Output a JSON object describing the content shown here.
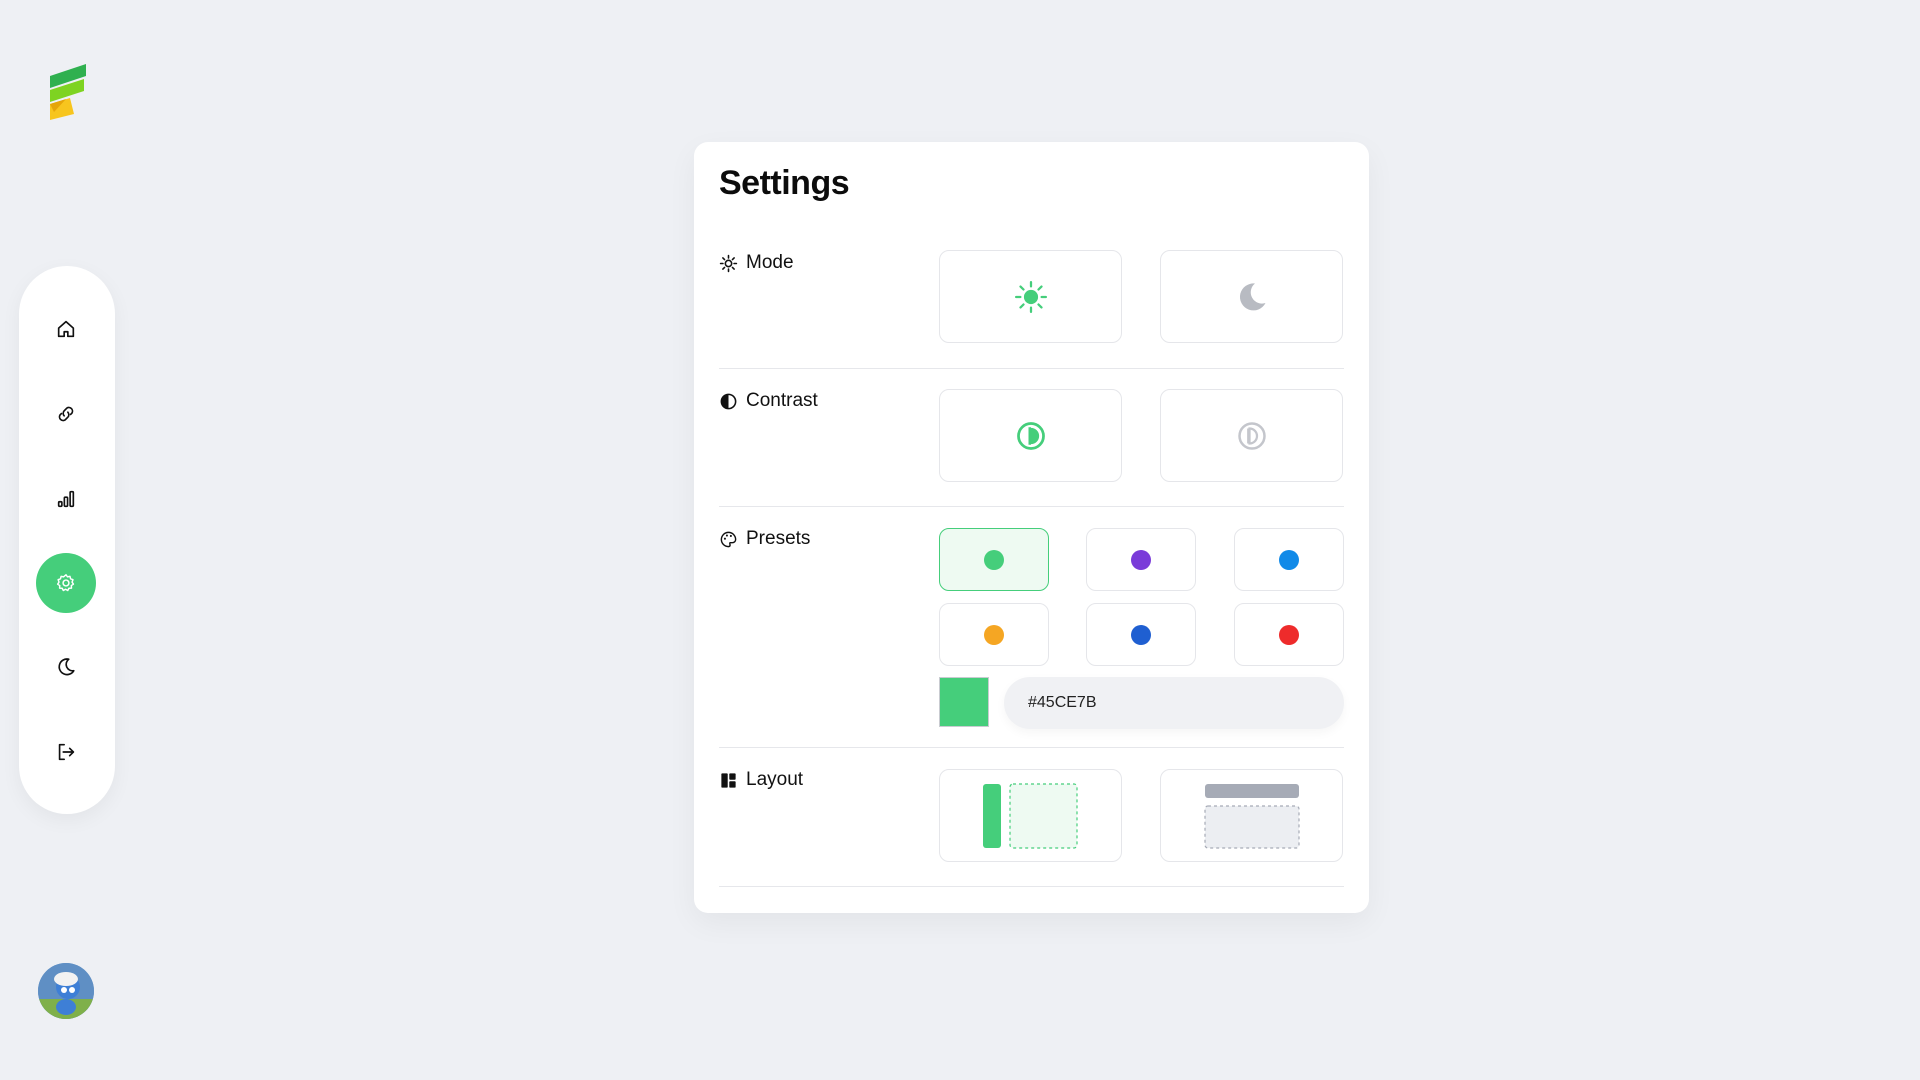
{
  "settings": {
    "title": "Settings",
    "mode": {
      "label": "Mode",
      "options": [
        {
          "name": "light",
          "icon": "sun-icon",
          "selected": true
        },
        {
          "name": "dark",
          "icon": "moon-icon",
          "selected": false
        }
      ]
    },
    "contrast": {
      "label": "Contrast",
      "options": [
        {
          "name": "default",
          "icon": "contrast-icon",
          "selected": true
        },
        {
          "name": "bold",
          "icon": "contrast-bold-icon",
          "selected": false
        }
      ]
    },
    "presets": {
      "label": "Presets",
      "colors": [
        "#45ce7b",
        "#7a3bd9",
        "#118ae8",
        "#f5a623",
        "#1f5fd1",
        "#ee2b2b"
      ],
      "selected_index": 0,
      "custom_color": "#45ce7b",
      "hex_value": "#45CE7B"
    },
    "layout": {
      "label": "Layout",
      "options": [
        {
          "name": "vertical",
          "selected": true
        },
        {
          "name": "horizontal",
          "selected": false
        }
      ]
    }
  },
  "sidebar": {
    "items": [
      {
        "name": "home",
        "icon": "home-icon"
      },
      {
        "name": "links",
        "icon": "link-icon"
      },
      {
        "name": "analytics",
        "icon": "bar-chart-icon"
      },
      {
        "name": "settings",
        "icon": "gear-icon",
        "active": true
      },
      {
        "name": "theme",
        "icon": "moon-icon"
      },
      {
        "name": "logout",
        "icon": "logout-icon"
      }
    ]
  },
  "colors": {
    "accent": "#45ce7b",
    "background": "#eef0f4",
    "panel": "#ffffff"
  }
}
